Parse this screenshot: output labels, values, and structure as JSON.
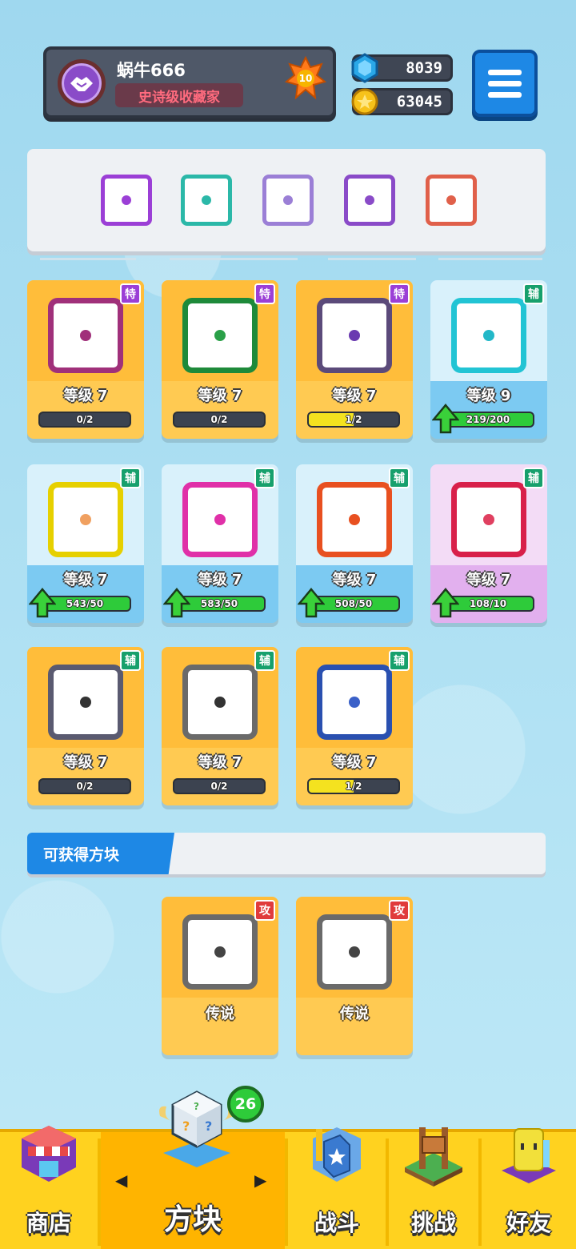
{
  "profile": {
    "name": "蜗牛666",
    "title": "史诗级收藏家",
    "level": "10"
  },
  "currency": {
    "gems": "8039",
    "coins": "63045"
  },
  "colors": {
    "accent_blue": "#1e88e5",
    "progress_yellow": "#f4e21f",
    "progress_green": "#2ecb3a",
    "nav_yellow": "#ffd21f"
  },
  "deck": {
    "slots": [
      {
        "icon": "saw-blade-icon",
        "color": "#9b3fd6"
      },
      {
        "icon": "healing-hands-icon",
        "color": "#2bb8a8"
      },
      {
        "icon": "crack-icon",
        "color": "#9b7fd6"
      },
      {
        "icon": "purple-orb-icon",
        "color": "#8a4bc8"
      },
      {
        "icon": "infinity-icon",
        "color": "#e0604a"
      }
    ]
  },
  "cards": [
    {
      "type": "特",
      "level": "等级 7",
      "progress": "0/2",
      "fraction": 0.0,
      "icon": "syringe-icon",
      "tile_color": "#a0307a",
      "dot_color": "#a0307a",
      "theme": "orange",
      "upgradable": false
    },
    {
      "type": "特",
      "level": "等级 7",
      "progress": "0/2",
      "fraction": 0.0,
      "icon": "vine-icon",
      "tile_color": "#1e8a3a",
      "dot_color": "#2aa048",
      "theme": "orange",
      "upgradable": false
    },
    {
      "type": "特",
      "level": "等级 7",
      "progress": "1/2",
      "fraction": 0.5,
      "icon": "vortex-icon",
      "tile_color": "#5b4a7a",
      "dot_color": "#6a3ab0",
      "theme": "orange",
      "upgradable": false
    },
    {
      "type": "辅",
      "level": "等级 9",
      "progress": "219/200",
      "fraction": 1.0,
      "icon": "plus-icon",
      "tile_color": "#22c4d4",
      "dot_color": "#22b8c8",
      "theme": "blue",
      "upgradable": true
    },
    {
      "type": "辅",
      "level": "等级 7",
      "progress": "543/50",
      "fraction": 1.0,
      "icon": "arrow-up-icon",
      "tile_color": "#e6d000",
      "dot_color": "#f0a060",
      "theme": "blue",
      "upgradable": true
    },
    {
      "type": "辅",
      "level": "等级 7",
      "progress": "583/50",
      "fraction": 1.0,
      "icon": "shield-icon",
      "tile_color": "#e030a8",
      "dot_color": "#e030a8",
      "theme": "blue",
      "upgradable": true
    },
    {
      "type": "辅",
      "level": "等级 7",
      "progress": "508/50",
      "fraction": 1.0,
      "icon": "sword-icon",
      "tile_color": "#e85020",
      "dot_color": "#e85020",
      "theme": "blue",
      "upgradable": true
    },
    {
      "type": "辅",
      "level": "等级 7",
      "progress": "108/10",
      "fraction": 1.0,
      "icon": "crit-plus-icon",
      "tile_color": "#d8204a",
      "dot_color": "#e04060",
      "theme": "purple",
      "upgradable": true
    },
    {
      "type": "辅",
      "level": "等级 7",
      "progress": "0/2",
      "fraction": 0.0,
      "icon": "jaws-icon",
      "tile_color": "#5a5a70",
      "dot_color": "#333",
      "theme": "orange",
      "upgradable": false
    },
    {
      "type": "辅",
      "level": "等级 7",
      "progress": "0/2",
      "fraction": 0.0,
      "icon": "target-ring-icon",
      "tile_color": "#6a6a6a",
      "dot_color": "#333",
      "theme": "orange",
      "upgradable": false
    },
    {
      "type": "辅",
      "level": "等级 7",
      "progress": "1/2",
      "fraction": 0.5,
      "icon": "moon-icon",
      "tile_color": "#2a50b0",
      "dot_color": "#3a60c8",
      "theme": "orange",
      "upgradable": false
    }
  ],
  "available": {
    "label": "可获得方块",
    "cards": [
      {
        "type": "攻",
        "rarity": "传说",
        "icon": "gear-icon"
      },
      {
        "type": "攻",
        "rarity": "传说",
        "icon": "star-icon"
      }
    ]
  },
  "nav": {
    "shop": "商店",
    "blocks": "方块",
    "battle": "战斗",
    "challenge": "挑战",
    "friends": "好友",
    "blocks_count": "26"
  }
}
